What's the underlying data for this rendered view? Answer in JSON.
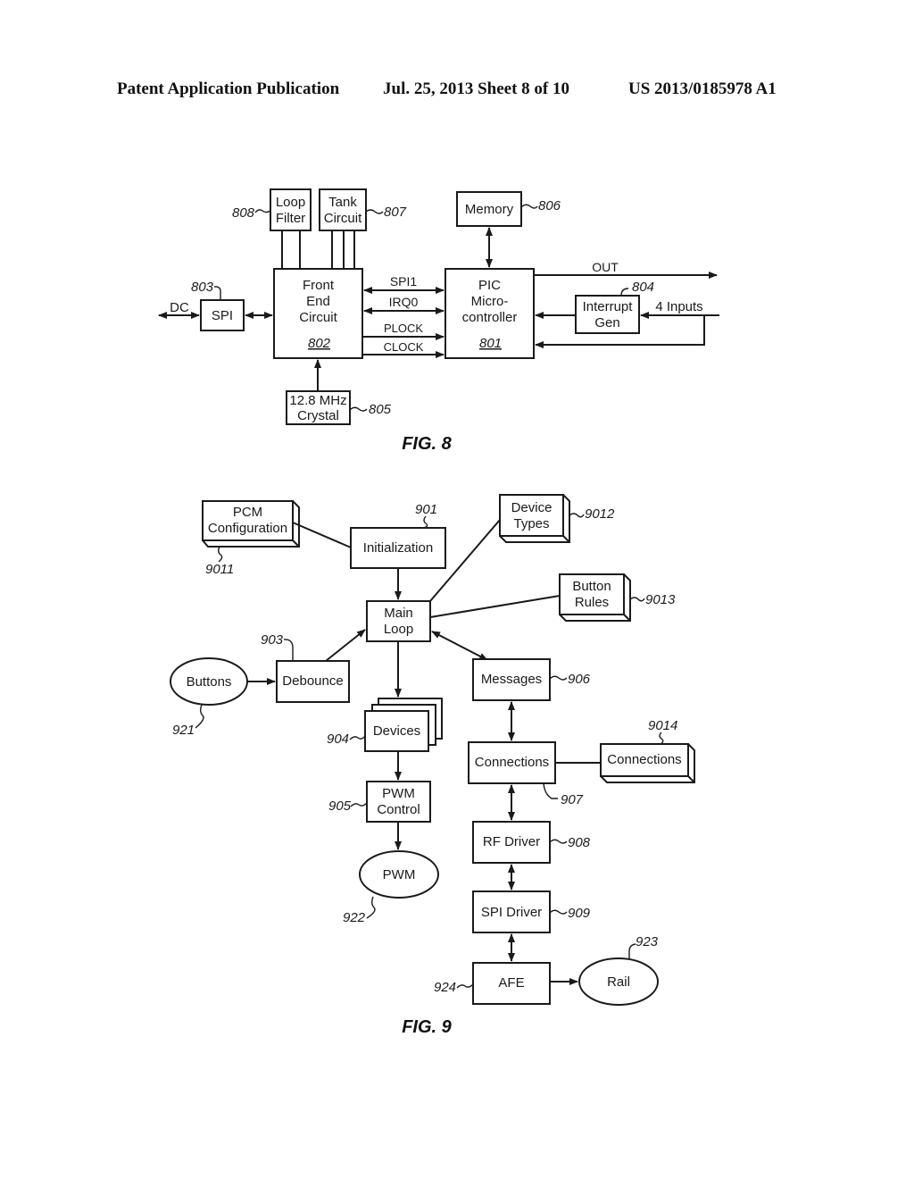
{
  "header": {
    "left": "Patent Application Publication",
    "date_sheet": "Jul. 25, 2013   Sheet 8 of 10",
    "number": "US 2013/0185978 A1"
  },
  "fig8": {
    "caption": "FIG. 8",
    "loop_filter": {
      "line1": "Loop",
      "line2": "Filter",
      "ref": "808"
    },
    "tank_circuit": {
      "line1": "Tank",
      "line2": "Circuit",
      "ref": "807"
    },
    "memory": {
      "label": "Memory",
      "ref": "806"
    },
    "spi": {
      "label": "SPI",
      "ref": "803"
    },
    "dc_label": "DC",
    "front_end": {
      "line1": "Front",
      "line2": "End",
      "line3": "Circuit",
      "ref": "802"
    },
    "pic": {
      "line1": "PIC",
      "line2": "Micro-",
      "line3": "controller",
      "ref": "801"
    },
    "interrupt_gen": {
      "line1": "Interrupt",
      "line2": "Gen",
      "ref": "804"
    },
    "crystal": {
      "line1": "12.8 MHz",
      "line2": "Crystal",
      "ref": "805"
    },
    "signals": {
      "spi1": "SPI1",
      "irq0": "IRQ0",
      "plock": "PLOCK",
      "clock": "CLOCK",
      "out": "OUT",
      "inputs": "4 Inputs"
    }
  },
  "fig9": {
    "caption": "FIG. 9",
    "pcm_config": {
      "line1": "PCM",
      "line2": "Configuration",
      "ref": "9011"
    },
    "initialization": {
      "label": "Initialization",
      "ref": "901"
    },
    "device_types": {
      "line1": "Device",
      "line2": "Types",
      "ref": "9012"
    },
    "button_rules": {
      "line1": "Button",
      "line2": "Rules",
      "ref": "9013"
    },
    "main_loop": {
      "line1": "Main",
      "line2": "Loop"
    },
    "buttons": {
      "label": "Buttons",
      "ref": "921"
    },
    "debounce": {
      "label": "Debounce",
      "ref": "903"
    },
    "messages": {
      "label": "Messages",
      "ref": "906"
    },
    "devices": {
      "label": "Devices",
      "ref": "904"
    },
    "connections": {
      "label": "Connections",
      "ref": "907"
    },
    "connections_store": {
      "label": "Connections",
      "ref": "9014"
    },
    "pwm_control": {
      "line1": "PWM",
      "line2": "Control",
      "ref": "905"
    },
    "pwm": {
      "label": "PWM",
      "ref": "922"
    },
    "rf_driver": {
      "label": "RF Driver",
      "ref": "908"
    },
    "spi_driver": {
      "label": "SPI Driver",
      "ref": "909"
    },
    "afe": {
      "label": "AFE",
      "ref": "924"
    },
    "rail": {
      "label": "Rail",
      "ref": "923"
    }
  }
}
